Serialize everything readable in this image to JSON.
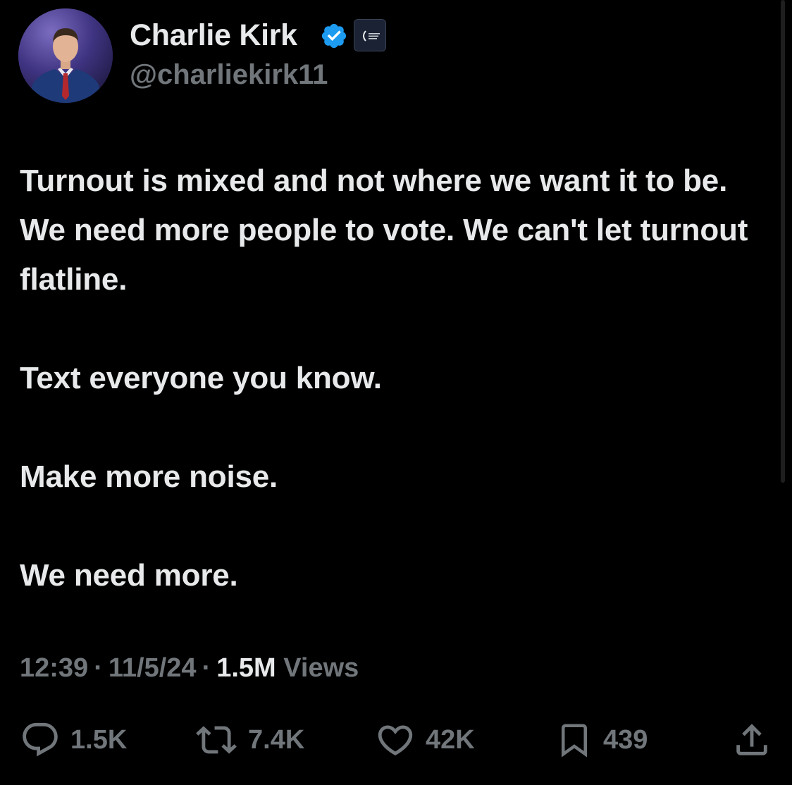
{
  "user": {
    "display_name": "Charlie Kirk",
    "handle": "@charliekirk11",
    "verified": true,
    "verified_color": "#1d9bf0"
  },
  "tweet": {
    "paragraphs": [
      "Turnout is mixed and not where we want it to be. We need more people to vote. We can't let turnout flatline.",
      "Text everyone you know.",
      "Make more noise.",
      "We need more."
    ]
  },
  "meta": {
    "time": "12:39",
    "date": "11/5/24",
    "separator": "·",
    "views_count": "1.5M",
    "views_label": "Views"
  },
  "actions": {
    "replies": "1.5K",
    "reposts": "7.4K",
    "likes": "42K",
    "bookmarks": "439"
  },
  "icons": {
    "reply": "speech-bubble-icon",
    "repost": "repost-arrows-icon",
    "like": "heart-icon",
    "bookmark": "bookmark-icon",
    "share": "share-upload-icon",
    "verified": "verified-check-badge-icon",
    "affiliate": "organization-badge-icon"
  },
  "colors": {
    "background": "#000000",
    "primary_text": "#e7e9ea",
    "secondary_text": "#71767b",
    "accent": "#1d9bf0"
  }
}
